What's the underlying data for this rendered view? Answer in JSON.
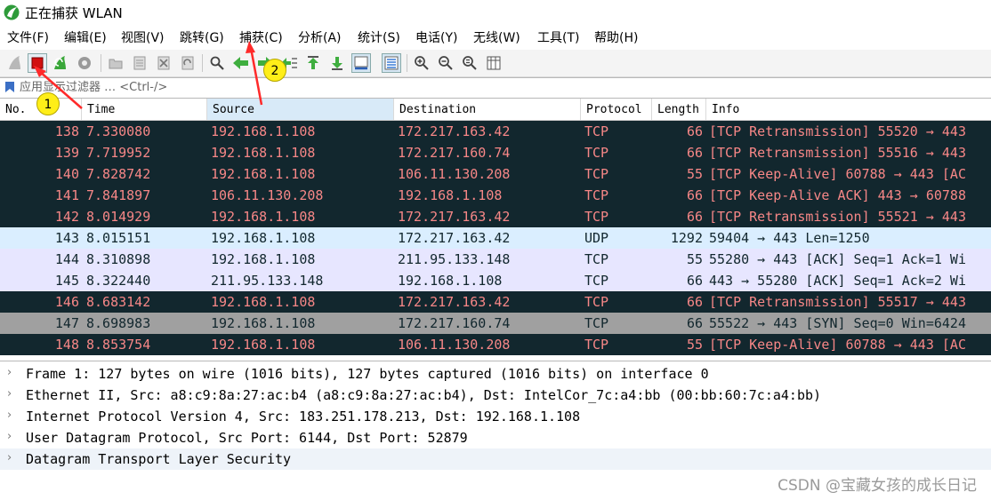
{
  "window": {
    "title": "正在捕获 WLAN"
  },
  "menu": [
    "文件(F)",
    "编辑(E)",
    "视图(V)",
    "跳转(G)",
    "捕获(C)",
    "分析(A)",
    "统计(S)",
    "电话(Y)",
    "无线(W)",
    "工具(T)",
    "帮助(H)"
  ],
  "toolbar": {
    "icons": [
      "shark-fin-start-icon",
      "stop-capture-icon",
      "restart-capture-icon",
      "capture-options-icon",
      "open-file-icon",
      "save-file-icon",
      "close-file-icon",
      "reload-file-icon",
      "find-packet-icon",
      "go-back-icon",
      "go-forward-icon",
      "go-to-packet-icon",
      "go-first-packet-icon",
      "go-last-packet-icon",
      "auto-scroll-icon",
      "colorize-icon",
      "zoom-in-icon",
      "zoom-out-icon",
      "zoom-normal-icon",
      "resize-columns-icon"
    ]
  },
  "filter": {
    "placeholder": "应用显示过滤器 … <Ctrl-/>"
  },
  "columns": [
    "No.",
    "Time",
    "Source",
    "Destination",
    "Protocol",
    "Length",
    "Info"
  ],
  "packets": [
    {
      "no": "138",
      "time": "7.330080",
      "source": "192.168.1.108",
      "destination": "172.217.163.42",
      "protocol": "TCP",
      "length": "66",
      "info": "[TCP Retransmission] 55520 → 443",
      "style": "bad"
    },
    {
      "no": "139",
      "time": "7.719952",
      "source": "192.168.1.108",
      "destination": "172.217.160.74",
      "protocol": "TCP",
      "length": "66",
      "info": "[TCP Retransmission] 55516 → 443",
      "style": "bad"
    },
    {
      "no": "140",
      "time": "7.828742",
      "source": "192.168.1.108",
      "destination": "106.11.130.208",
      "protocol": "TCP",
      "length": "55",
      "info": "[TCP Keep-Alive] 60788 → 443 [AC",
      "style": "bad"
    },
    {
      "no": "141",
      "time": "7.841897",
      "source": "106.11.130.208",
      "destination": "192.168.1.108",
      "protocol": "TCP",
      "length": "66",
      "info": "[TCP Keep-Alive ACK] 443 → 60788",
      "style": "bad"
    },
    {
      "no": "142",
      "time": "8.014929",
      "source": "192.168.1.108",
      "destination": "172.217.163.42",
      "protocol": "TCP",
      "length": "66",
      "info": "[TCP Retransmission] 55521 → 443",
      "style": "bad"
    },
    {
      "no": "143",
      "time": "8.015151",
      "source": "192.168.1.108",
      "destination": "172.217.163.42",
      "protocol": "UDP",
      "length": "1292",
      "info": "59404 → 443 Len=1250",
      "style": "udp"
    },
    {
      "no": "144",
      "time": "8.310898",
      "source": "192.168.1.108",
      "destination": "211.95.133.148",
      "protocol": "TCP",
      "length": "55",
      "info": "55280 → 443 [ACK] Seq=1 Ack=1 Wi",
      "style": "tcp"
    },
    {
      "no": "145",
      "time": "8.322440",
      "source": "211.95.133.148",
      "destination": "192.168.1.108",
      "protocol": "TCP",
      "length": "66",
      "info": "443 → 55280 [ACK] Seq=1 Ack=2 Wi",
      "style": "tcp"
    },
    {
      "no": "146",
      "time": "8.683142",
      "source": "192.168.1.108",
      "destination": "172.217.163.42",
      "protocol": "TCP",
      "length": "66",
      "info": "[TCP Retransmission] 55517 → 443",
      "style": "bad"
    },
    {
      "no": "147",
      "time": "8.698983",
      "source": "192.168.1.108",
      "destination": "172.217.160.74",
      "protocol": "TCP",
      "length": "66",
      "info": "55522 → 443 [SYN] Seq=0 Win=6424",
      "style": "syn"
    },
    {
      "no": "148",
      "time": "8.853754",
      "source": "192.168.1.108",
      "destination": "106.11.130.208",
      "protocol": "TCP",
      "length": "55",
      "info": "[TCP Keep-Alive] 60788 → 443 [AC",
      "style": "bad"
    }
  ],
  "row_colors": {
    "bad": {
      "bg": "#12272e",
      "fg": "#f78787"
    },
    "udp": {
      "bg": "#daeeff",
      "fg": "#12272e"
    },
    "tcp": {
      "bg": "#e7e6ff",
      "fg": "#12272e"
    },
    "syn": {
      "bg": "#a0a0a0",
      "fg": "#12272e"
    }
  },
  "details": [
    "Frame 1: 127 bytes on wire (1016 bits), 127 bytes captured (1016 bits) on interface 0",
    "Ethernet II, Src: a8:c9:8a:27:ac:b4 (a8:c9:8a:27:ac:b4), Dst: IntelCor_7c:a4:bb (00:bb:60:7c:a4:bb)",
    "Internet Protocol Version 4, Src: 183.251.178.213, Dst: 192.168.1.108",
    "User Datagram Protocol, Src Port: 6144, Dst Port: 52879",
    "Datagram Transport Layer Security"
  ],
  "annotations": {
    "marker1": "1",
    "marker2": "2"
  },
  "watermark": "CSDN @宝藏女孩的成长日记"
}
